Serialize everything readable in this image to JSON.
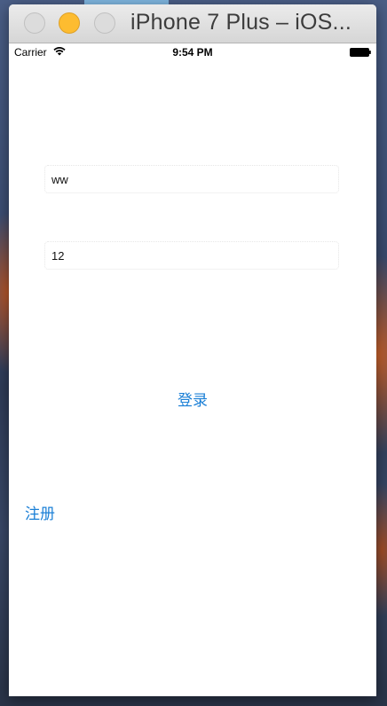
{
  "window": {
    "title": "iPhone 7 Plus – iOS..."
  },
  "status_bar": {
    "carrier": "Carrier",
    "time": "9:54 PM"
  },
  "form": {
    "username_value": "ww",
    "password_value": "12",
    "login_label": "登录",
    "register_label": "注册"
  },
  "icons": {
    "wifi": "wifi-icon",
    "battery": "battery-icon"
  },
  "colors": {
    "accent": "#1a7fd6",
    "minimize_button": "#fdbc30"
  }
}
